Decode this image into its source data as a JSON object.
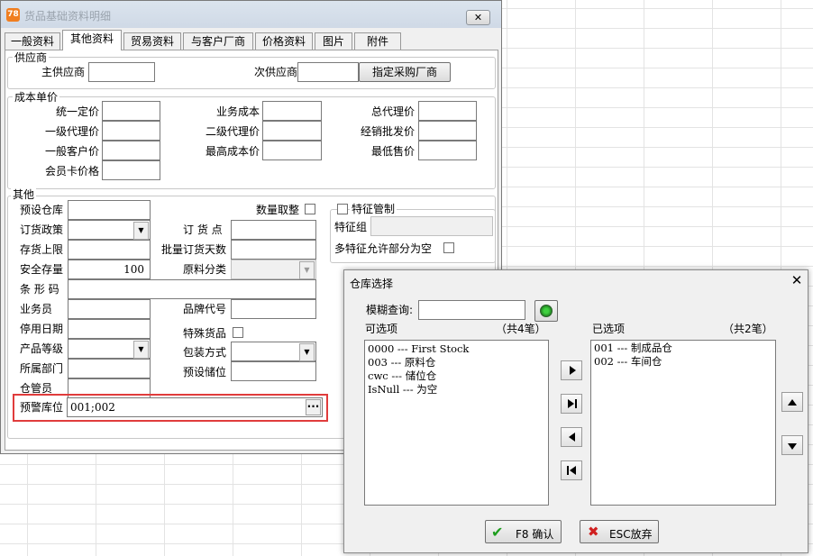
{
  "window": {
    "title": "货品基础资料明细",
    "logo_text": "78",
    "close_glyph": "✕"
  },
  "tabs": [
    "一般资料",
    "其他资料",
    "贸易资料",
    "与客户厂商",
    "价格资料",
    "图片",
    "附件"
  ],
  "supplier": {
    "legend": "供应商",
    "main_label": "主供应商",
    "secondary_label": "次供应商",
    "assign_button": "指定采购厂商"
  },
  "cost": {
    "legend": "成本单价",
    "col1": [
      "统一定价",
      "一级代理价",
      "一般客户价",
      "会员卡价格"
    ],
    "col2": [
      "业务成本",
      "二级代理价",
      "最高成本价"
    ],
    "col3": [
      "总代理价",
      "经销批发价",
      "最低售价"
    ]
  },
  "other": {
    "legend": "其他",
    "default_warehouse": "预设仓库",
    "order_policy": "订货政策",
    "stock_upper": "存货上限",
    "safety_stock": "安全存量",
    "safety_stock_value": "100",
    "barcode": "条 形 码",
    "salesman": "业务员",
    "disable_date": "停用日期",
    "product_grade": "产品等级",
    "department": "所属部门",
    "warehouse_keeper": "仓管员",
    "alert_location": "预警库位",
    "alert_location_value": "001;002",
    "ellipsis": "···",
    "round_qty": "数量取整",
    "order_point": "订 货 点",
    "batch_order_days": "批量订货天数",
    "material_class": "原料分类",
    "brand_code": "品牌代号",
    "special_goods": "特殊货品",
    "packing": "包装方式",
    "default_location": "预设储位"
  },
  "feature": {
    "legend": "特征管制",
    "group_label": "特征组",
    "allow_partial": "多特征允许部分为空"
  },
  "dialog": {
    "title": "仓库选择",
    "close_glyph": "✕",
    "fuzzy_label": "模糊查询:",
    "available_label": "可选项",
    "available_count": "（共4笔）",
    "selected_label": "已选项",
    "selected_count": "（共2笔）",
    "available_items": [
      "0000 --- First Stock",
      "003 --- 原料仓",
      "cwc --- 储位仓",
      "IsNull --- 为空"
    ],
    "selected_items": [
      "001 --- 制成品仓",
      "002 --- 车间仓"
    ],
    "confirm_label": "F8 确认",
    "cancel_label": "ESC放弃",
    "confirm_icon": "✔",
    "cancel_icon": "✖"
  }
}
